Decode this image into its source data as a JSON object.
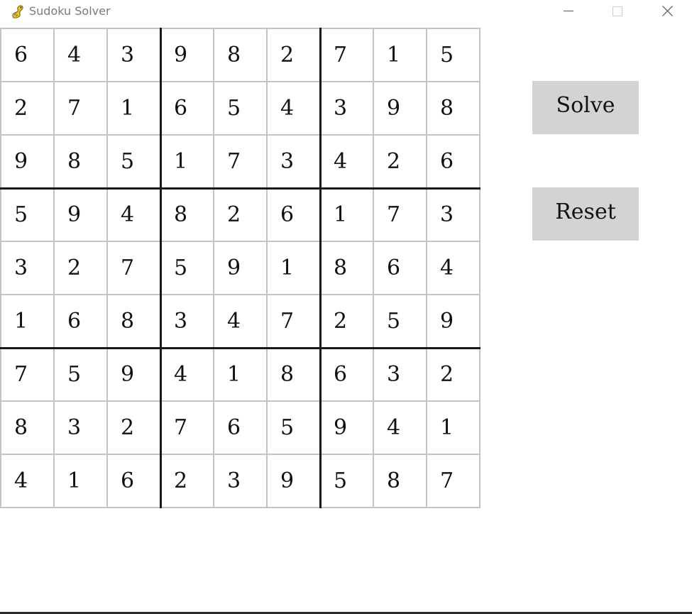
{
  "window": {
    "title": "Sudoku Solver",
    "app_icon": "python-snake-icon",
    "controls": {
      "minimize_icon": "minimize-icon",
      "maximize_icon": "maximize-icon",
      "close_icon": "close-icon"
    }
  },
  "board": {
    "rows": [
      [
        6,
        4,
        3,
        9,
        8,
        2,
        7,
        1,
        5
      ],
      [
        2,
        7,
        1,
        6,
        5,
        4,
        3,
        9,
        8
      ],
      [
        9,
        8,
        5,
        1,
        7,
        3,
        4,
        2,
        6
      ],
      [
        5,
        9,
        4,
        8,
        2,
        6,
        1,
        7,
        3
      ],
      [
        3,
        2,
        7,
        5,
        9,
        1,
        8,
        6,
        4
      ],
      [
        1,
        6,
        8,
        3,
        4,
        7,
        2,
        5,
        9
      ],
      [
        7,
        5,
        9,
        4,
        1,
        8,
        6,
        3,
        2
      ],
      [
        8,
        3,
        2,
        7,
        6,
        5,
        9,
        4,
        1
      ],
      [
        4,
        1,
        6,
        2,
        3,
        9,
        5,
        8,
        7
      ]
    ],
    "colors": {
      "thin_line": "#c4c4c4",
      "thick_line": "#1a1a1a",
      "digit": "#111111"
    }
  },
  "buttons": {
    "solve_label": "Solve",
    "reset_label": "Reset",
    "background": "#d3d3d3"
  }
}
